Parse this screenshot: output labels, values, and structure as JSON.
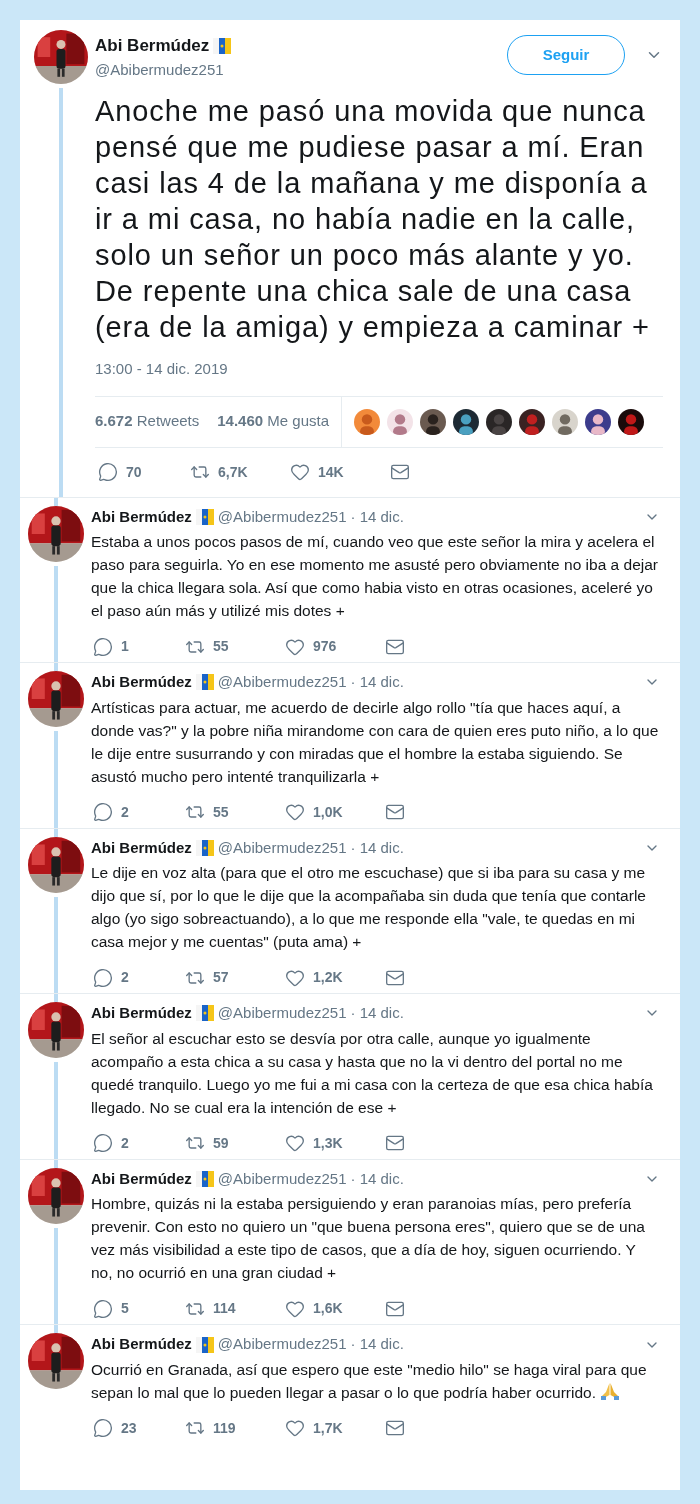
{
  "tweet": {
    "author": {
      "name": "Abi Bermúdez",
      "handle": "@Abibermudez251"
    },
    "follow_button": "Seguir",
    "text": "Anoche me pasó una movida que nunca pensé que me pudiese pasar a mí. Eran casi las 4 de la mañana y me disponía a ir a mi casa, no había nadie en la calle, solo un señor un poco más alante y yo. De repente una chica sale de una casa (era de la amiga) y empieza a caminar +",
    "timestamp": "13:00 - 14 dic. 2019",
    "stats": [
      "**6.672** Retweets",
      "**14.460** Me gusta"
    ],
    "actions": {
      "replies": "70",
      "retweets": "6,7K",
      "likes": "14K"
    }
  },
  "replies": [
    {
      "name": "Abi Bermúdez",
      "handle": "@Abibermudez251",
      "date": "· 14 dic.",
      "text": "Estaba a unos pocos pasos de mí,  cuando veo que este señor la mira y acelera el paso para seguirla. Yo en ese momento me asusté pero obviamente no iba a dejar que la chica llegara sola. Así que como habia visto en otras ocasiones, aceleré yo el paso aún más y utilizé mis dotes +",
      "actions": {
        "replies": "1",
        "retweets": "55",
        "likes": "976"
      }
    },
    {
      "name": "Abi Bermúdez",
      "handle": "@Abibermudez251",
      "date": "· 14 dic.",
      "text": "Artísticas para actuar, me acuerdo de decirle algo rollo \"tía que haces aquí, a donde vas?\" y la pobre niña mirandome con cara de quien eres puto niño, a lo que le dije entre susurrando y con miradas que el hombre la estaba siguiendo. Se asustó mucho pero intenté tranquilizarla +",
      "actions": {
        "replies": "2",
        "retweets": "55",
        "likes": "1,0K"
      }
    },
    {
      "name": "Abi Bermúdez",
      "handle": "@Abibermudez251",
      "date": "· 14 dic.",
      "text": "Le dije en voz alta (para que el otro me escuchase) que si iba para su casa y me dijo que sí, por lo que le dije que la acompañaba sin duda que tenía que contarle algo (yo sigo sobreactuando), a lo que me responde ella \"vale, te quedas en mi casa mejor y me cuentas\" (puta ama) +",
      "actions": {
        "replies": "2",
        "retweets": "57",
        "likes": "1,2K"
      }
    },
    {
      "name": "Abi Bermúdez",
      "handle": "@Abibermudez251",
      "date": "· 14 dic.",
      "text": "El señor al escuchar esto se desvía por otra calle, aunque yo igualmente acompaño a esta chica a su casa y hasta que no la vi dentro del portal no me quedé tranquilo. Luego yo me fui a mi casa con la certeza de que esa chica había llegado. No se cual era la intención de ese +",
      "actions": {
        "replies": "2",
        "retweets": "59",
        "likes": "1,3K"
      }
    },
    {
      "name": "Abi Bermúdez",
      "handle": "@Abibermudez251",
      "date": "· 14 dic.",
      "text": "Hombre, quizás ni la estaba persiguiendo y eran paranoias mías, pero prefería prevenir. Con esto no quiero un \"que buena persona eres\", quiero que se de una vez más visibilidad a este tipo de casos, que a día de hoy, siguen ocurriendo. Y no, no ocurrió en una gran ciudad +",
      "actions": {
        "replies": "5",
        "retweets": "114",
        "likes": "1,6K"
      }
    },
    {
      "name": "Abi Bermúdez",
      "handle": "@Abibermudez251",
      "date": "· 14 dic.",
      "text": "Ocurrió en Granada, así que espero que este \"medio hilo\" se haga viral para que sepan lo mal que lo pueden llegar a pasar o lo que podría haber ocurrido.",
      "actions": {
        "replies": "23",
        "retweets": "119",
        "likes": "1,7K"
      }
    }
  ]
}
